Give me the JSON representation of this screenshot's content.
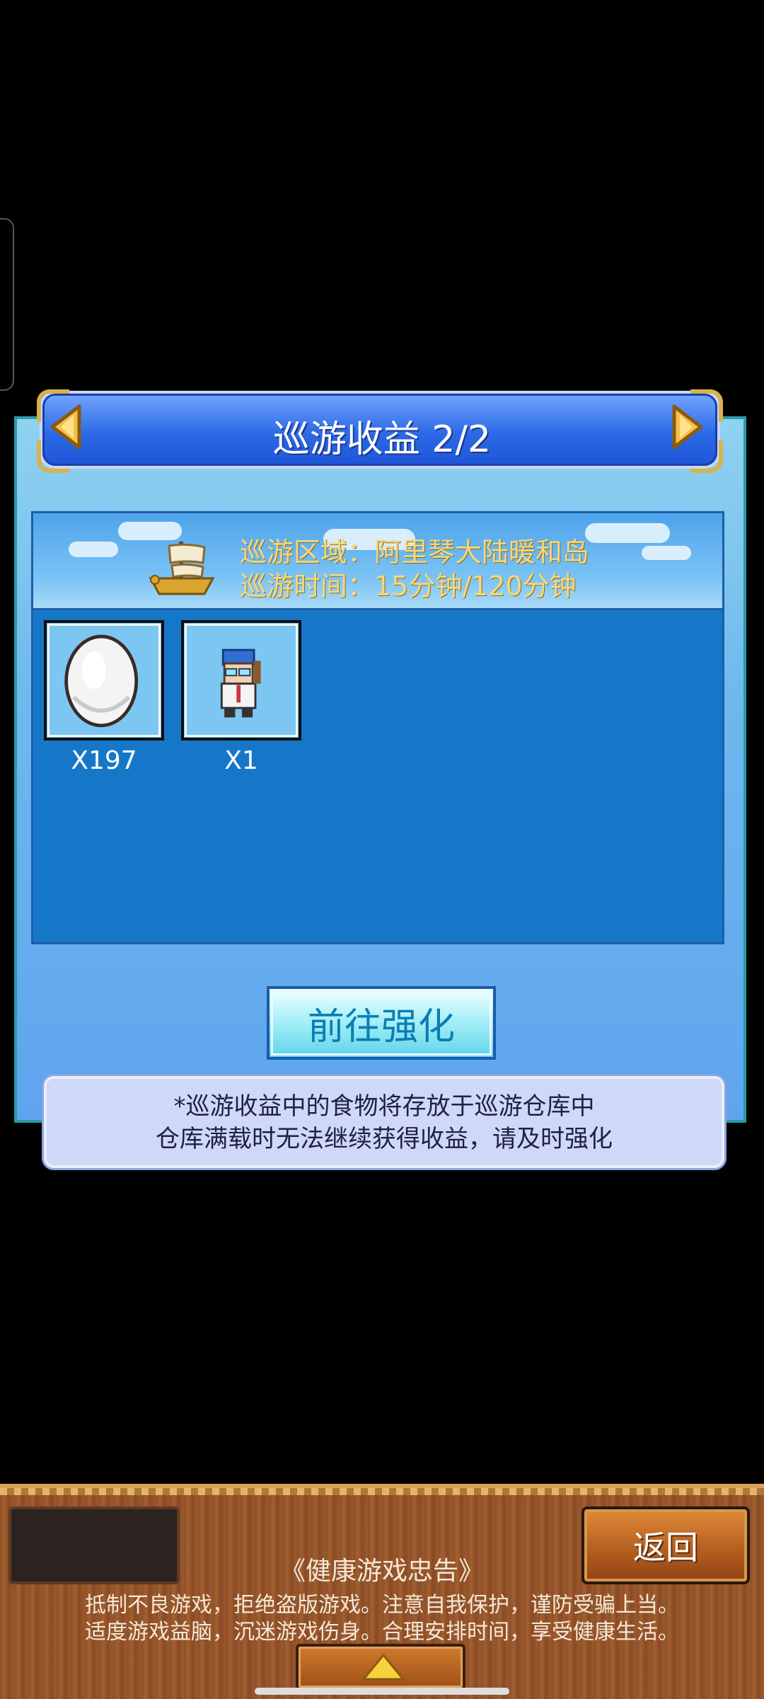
{
  "dialog": {
    "title": "巡游收益 2/2",
    "area_line": "巡游区域：阿里琴大陆暖和岛",
    "time_line": "巡游时间：15分钟/120分钟",
    "rewards": [
      {
        "icon": "egg-icon",
        "count": "X197"
      },
      {
        "icon": "character-icon",
        "count": "X1"
      }
    ],
    "upgrade_label": "前往强化",
    "notice_lines": [
      "*巡游收益中的食物将存放于巡游仓库中",
      "仓库满载时无法继续获得收益，请及时强化"
    ]
  },
  "bottom_bar": {
    "back_label": "返回",
    "health_title": "《健康游戏忠告》",
    "health_lines": [
      "抵制不良游戏，拒绝盗版游戏。注意自我保护，谨防受骗上当。",
      "适度游戏益脑，沉迷游戏伤身。合理安排时间，享受健康生活。"
    ]
  },
  "colors": {
    "accent_gold": "#f6d77b",
    "panel_blue": "#1677c9",
    "button_cyan": "#0b7db2",
    "wood_brown": "#9b5a2d"
  }
}
